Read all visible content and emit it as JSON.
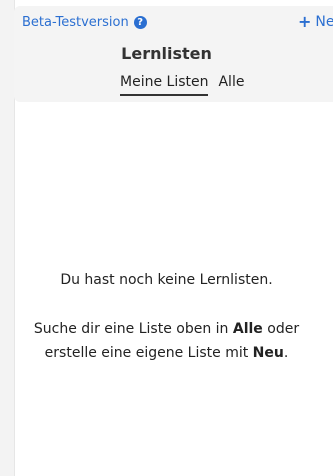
{
  "header": {
    "beta_label": "Beta-Testversion",
    "help_icon_glyph": "?",
    "new_label": "Neu",
    "title": "Lernlisten"
  },
  "tabs": [
    {
      "label": "Meine Listen",
      "active": true
    },
    {
      "label": "Alle",
      "active": false
    }
  ],
  "empty_state": {
    "headline": "Du hast noch keine Lernlisten.",
    "line1_pre": "Suche dir eine Liste oben in ",
    "line1_bold": "Alle",
    "line1_post": " oder",
    "line2_pre": "erstelle eine eigene Liste mit ",
    "line2_bold": "Neu",
    "line2_post": "."
  },
  "colors": {
    "accent": "#2b6fd1",
    "header_bg": "#f4f4f4"
  }
}
